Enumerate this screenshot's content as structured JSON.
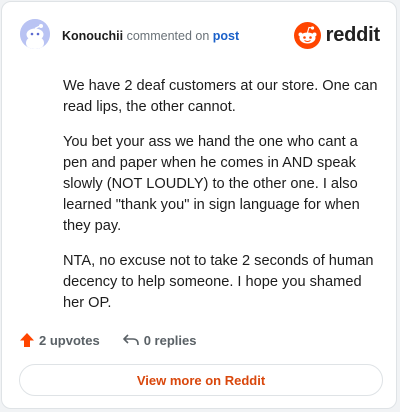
{
  "comment": {
    "author": "Konouchii",
    "action_text": "commented on",
    "post_link": "post",
    "paragraphs": [
      "We have 2 deaf customers at our store. One can read lips, the other cannot.",
      "You bet your ass we hand the one who cant a pen and paper when he comes in AND speak slowly (NOT LOUDLY) to the other one. I also learned \"thank you\" in sign language for when they pay.",
      "NTA, no excuse not to take 2 seconds of human decency to help someone. I hope you shamed her OP."
    ],
    "upvotes_label": "2 upvotes",
    "replies_label": "0 replies"
  },
  "brand": {
    "name": "reddit",
    "icon": "reddit-logo-icon",
    "color": "#ff4500"
  },
  "footer": {
    "view_more_label": "View more on Reddit"
  },
  "icons": {
    "avatar": "snoo-avatar-icon",
    "upvote": "upvote-arrow-icon",
    "reply": "reply-arrow-icon"
  },
  "colors": {
    "accent": "#ff4500",
    "link": "#1a60c9",
    "view_more_text": "#d9470c"
  }
}
